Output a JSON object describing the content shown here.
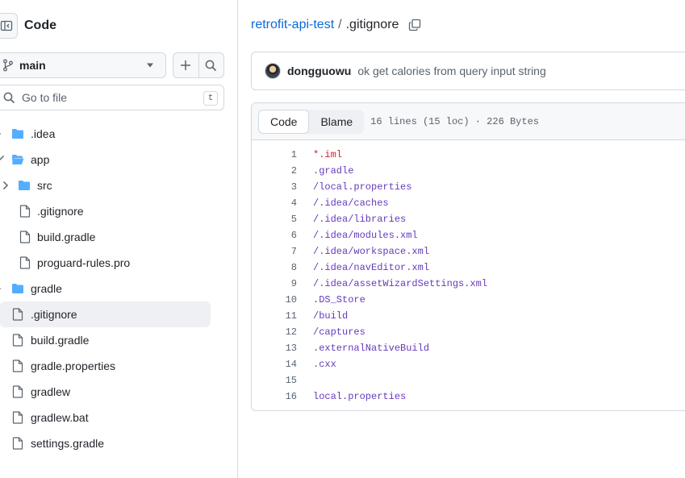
{
  "sidebar": {
    "title": "Code",
    "branch": "main",
    "goto_placeholder": "Go to file",
    "goto_shortcut": "t",
    "tree": [
      {
        "name": ".idea",
        "type": "folder",
        "depth": 0,
        "expanded": false
      },
      {
        "name": "app",
        "type": "folder",
        "depth": 0,
        "expanded": true
      },
      {
        "name": "src",
        "type": "folder",
        "depth": 1,
        "expanded": false
      },
      {
        "name": ".gitignore",
        "type": "file",
        "depth": 1
      },
      {
        "name": "build.gradle",
        "type": "file",
        "depth": 1
      },
      {
        "name": "proguard-rules.pro",
        "type": "file",
        "depth": 1
      },
      {
        "name": "gradle",
        "type": "folder",
        "depth": 0,
        "expanded": false
      },
      {
        "name": ".gitignore",
        "type": "file",
        "depth": 0,
        "selected": true
      },
      {
        "name": "build.gradle",
        "type": "file",
        "depth": 0
      },
      {
        "name": "gradle.properties",
        "type": "file",
        "depth": 0
      },
      {
        "name": "gradlew",
        "type": "file",
        "depth": 0
      },
      {
        "name": "gradlew.bat",
        "type": "file",
        "depth": 0
      },
      {
        "name": "settings.gradle",
        "type": "file",
        "depth": 0
      }
    ]
  },
  "breadcrumb": {
    "repo": "retrofit-api-test",
    "separator": "/",
    "file": ".gitignore"
  },
  "commit": {
    "author": "dongguowu",
    "message": "ok get calories from query input string"
  },
  "file_view": {
    "tabs": [
      "Code",
      "Blame"
    ],
    "active_tab": "Code",
    "meta": "16 lines (15 loc) · 226 Bytes",
    "lines": [
      {
        "n": "1",
        "text": "*.iml"
      },
      {
        "n": "2",
        "text": ".gradle"
      },
      {
        "n": "3",
        "text": "/local.properties"
      },
      {
        "n": "4",
        "text": "/.idea/caches"
      },
      {
        "n": "5",
        "text": "/.idea/libraries"
      },
      {
        "n": "6",
        "text": "/.idea/modules.xml"
      },
      {
        "n": "7",
        "text": "/.idea/workspace.xml"
      },
      {
        "n": "8",
        "text": "/.idea/navEditor.xml"
      },
      {
        "n": "9",
        "text": "/.idea/assetWizardSettings.xml"
      },
      {
        "n": "10",
        "text": ".DS_Store"
      },
      {
        "n": "11",
        "text": "/build"
      },
      {
        "n": "12",
        "text": "/captures"
      },
      {
        "n": "13",
        "text": ".externalNativeBuild"
      },
      {
        "n": "14",
        "text": ".cxx"
      },
      {
        "n": "15",
        "text": ""
      },
      {
        "n": "16",
        "text": "local.properties"
      }
    ]
  },
  "colors": {
    "link": "#0969da",
    "accent": "#fd8c73",
    "folder": "#54aeff",
    "code_purple": "#6639ba",
    "code_red": "#cf222e"
  }
}
